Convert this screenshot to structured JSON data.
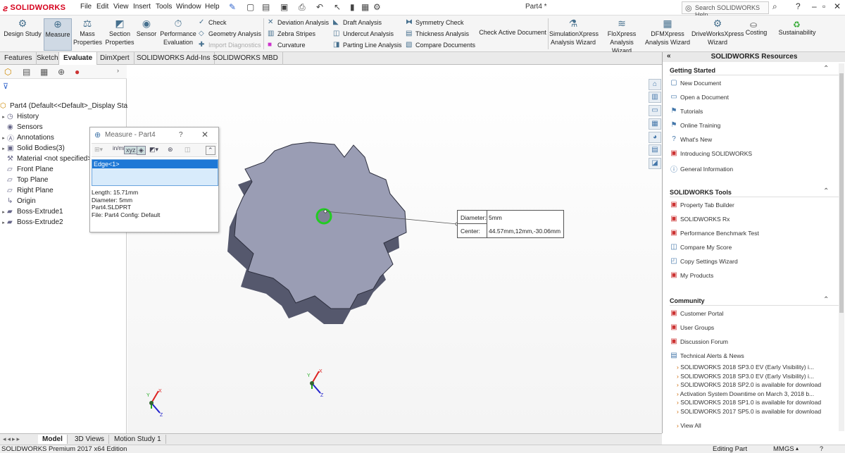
{
  "app": {
    "brand": "SOLIDWORKS",
    "doc_title": "Part4 *"
  },
  "menu": [
    "File",
    "Edit",
    "View",
    "Insert",
    "Tools",
    "Window",
    "Help"
  ],
  "search": {
    "placeholder": "Search SOLIDWORKS Help"
  },
  "ribbon": {
    "design_study": "Design Study",
    "measure": "Measure",
    "mass_properties": [
      "Mass",
      "Properties"
    ],
    "section_properties": [
      "Section",
      "Properties"
    ],
    "sensor": "Sensor",
    "performance_evaluation": [
      "Performance",
      "Evaluation"
    ],
    "check": "Check",
    "geometry_analysis": "Geometry Analysis",
    "import_diagnostics": "Import Diagnostics",
    "deviation_analysis": "Deviation Analysis",
    "zebra_stripes": "Zebra Stripes",
    "curvature": "Curvature",
    "draft_analysis": "Draft Analysis",
    "undercut_analysis": "Undercut Analysis",
    "parting_line_analysis": "Parting Line Analysis",
    "symmetry_check": "Symmetry Check",
    "thickness_analysis": "Thickness Analysis",
    "compare_documents": "Compare Documents",
    "check_active_document": "Check Active Document",
    "simulationxpress": [
      "SimulationXpress",
      "Analysis Wizard"
    ],
    "floxpress": [
      "FloXpress",
      "Analysis Wizard"
    ],
    "dfmxpress": [
      "DFMXpress",
      "Analysis Wizard"
    ],
    "driveworksxpress": [
      "DriveWorksXpress",
      "Wizard"
    ],
    "costing": "Costing",
    "sustainability": "Sustainability"
  },
  "command_tabs": [
    "Features",
    "Sketch",
    "Evaluate",
    "DimXpert",
    "SOLIDWORKS Add-Ins",
    "SOLIDWORKS MBD"
  ],
  "active_command_tab": "Evaluate",
  "feature_tree": {
    "root": "Part4  (Default<<Default>_Display State",
    "items": [
      "History",
      "Sensors",
      "Annotations",
      "Solid Bodies(3)",
      "Material <not specified>",
      "Front Plane",
      "Top Plane",
      "Right Plane",
      "Origin",
      "Boss-Extrude1",
      "Boss-Extrude2"
    ]
  },
  "measure_dialog": {
    "title": "Measure - Part4",
    "help": "?",
    "units_label": "in/mm",
    "selection": "Edge<1>",
    "results": [
      "Length: 15.71mm",
      "Diameter: 5mm",
      "Part4.SLDPRT",
      "File: Part4 Config: Default"
    ]
  },
  "callout": {
    "diameter_label": "Diameter:",
    "diameter_value": "5mm",
    "center_label": "Center:",
    "center_value": "44.57mm,12mm,-30.06mm"
  },
  "triad": {
    "x": "X",
    "y": "Y",
    "z": "Z"
  },
  "resources": {
    "header": "SOLIDWORKS Resources",
    "getting_started": {
      "title": "Getting Started",
      "items": [
        "New Document",
        "Open a Document",
        "Tutorials",
        "Online Training",
        "What's New",
        "Introducing SOLIDWORKS",
        "General Information"
      ]
    },
    "tools": {
      "title": "SOLIDWORKS Tools",
      "items": [
        "Property Tab Builder",
        "SOLIDWORKS Rx",
        "Performance Benchmark Test",
        "Compare My Score",
        "Copy Settings Wizard",
        "My Products"
      ]
    },
    "community": {
      "title": "Community",
      "items": [
        "Customer Portal",
        "User Groups",
        "Discussion Forum",
        "Technical Alerts & News"
      ],
      "news": [
        "SOLIDWORKS 2018 SP3.0 EV (Early Visibility) i...",
        "SOLIDWORKS 2018 SP3.0 EV (Early Visibility) i...",
        "SOLIDWORKS 2018 SP2.0 is available for download",
        "Activation System Downtime on March 3, 2018 b...",
        "SOLIDWORKS 2018 SP1.0 is available for download",
        "SOLIDWORKS 2017 SP5.0 is available for download"
      ],
      "view_all": "View All"
    }
  },
  "bottom_tabs": [
    "Model",
    "3D Views",
    "Motion Study 1"
  ],
  "status": {
    "edition": "SOLIDWORKS Premium 2017 x64 Edition",
    "mode": "Editing Part",
    "units": "MMGS"
  },
  "colors": {
    "brand": "#d6001c",
    "accent": "#1e78d6",
    "selection": "#22cc22",
    "gear": "#9a9db4"
  }
}
